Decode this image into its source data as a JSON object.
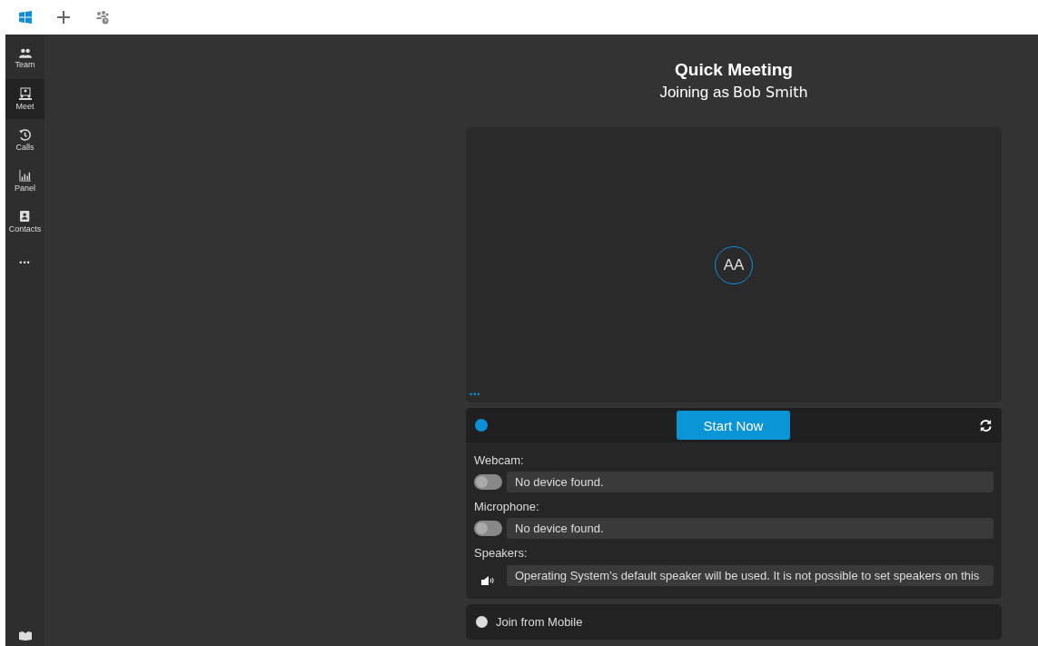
{
  "sidebar": {
    "items": [
      {
        "label": "Team",
        "selected": false
      },
      {
        "label": "Meet",
        "selected": true
      },
      {
        "label": "Calls",
        "selected": false
      },
      {
        "label": "Panel",
        "selected": false
      },
      {
        "label": "Contacts",
        "selected": false
      },
      {
        "label": "•••",
        "selected": false
      }
    ]
  },
  "header": {
    "title": "Quick Meeting",
    "subtitle": "Joining as",
    "name": "Bob Smith"
  },
  "preview": {
    "avatar": "AA",
    "more": "•••"
  },
  "controls": {
    "status_on": true,
    "start_button": "Start Now",
    "devices": [
      {
        "kind": "toggle",
        "label": "Webcam:",
        "on": false,
        "value": "No device found."
      },
      {
        "kind": "toggle",
        "label": "Microphone:",
        "on": false,
        "value": "No device found."
      },
      {
        "kind": "speaker",
        "label": "Speakers:",
        "value": "Operating System’s default speaker will be used. It is not possible to set speakers on this"
      }
    ]
  },
  "mobile": {
    "label": "Join from Mobile",
    "selected": false
  }
}
